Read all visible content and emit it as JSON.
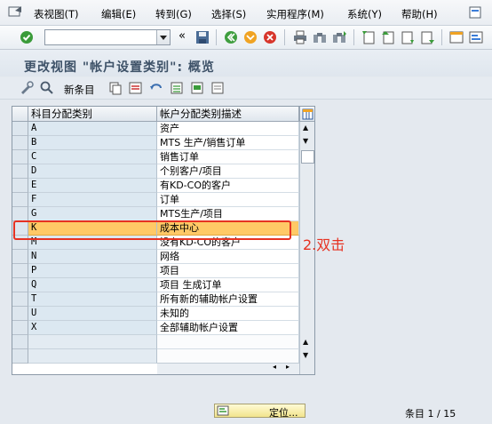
{
  "menu": {
    "items": [
      "表视图(T)",
      "编辑(E)",
      "转到(G)",
      "选择(S)",
      "实用程序(M)",
      "系统(Y)",
      "帮助(H)"
    ]
  },
  "toolbar": {
    "command_field": "",
    "icons": [
      "enter-icon",
      "save-icon",
      "back-icon",
      "exit-icon",
      "cancel-icon",
      "print-icon",
      "find-icon",
      "find-next-icon",
      "first-page-icon",
      "prev-page-icon",
      "next-page-icon",
      "last-page-icon",
      "new-session-icon",
      "shortcut-icon"
    ]
  },
  "screen": {
    "title": "更改视图 \"帐户设置类别\": 概览"
  },
  "app_toolbar": {
    "new_entries": "新条目"
  },
  "table": {
    "headers": [
      "科目分配类别",
      "帐户分配类别描述"
    ],
    "rows": [
      {
        "code": "A",
        "desc": "资产"
      },
      {
        "code": "B",
        "desc": "MTS 生产/销售订单"
      },
      {
        "code": "C",
        "desc": "销售订单"
      },
      {
        "code": "D",
        "desc": "个别客户/项目"
      },
      {
        "code": "E",
        "desc": "有KD-CO的客户"
      },
      {
        "code": "F",
        "desc": "订单"
      },
      {
        "code": "G",
        "desc": "MTS生产/项目"
      },
      {
        "code": "K",
        "desc": "成本中心"
      },
      {
        "code": "M",
        "desc": "没有KD-CO的客户"
      },
      {
        "code": "N",
        "desc": "网络"
      },
      {
        "code": "P",
        "desc": "项目"
      },
      {
        "code": "Q",
        "desc": "项目 生成订单"
      },
      {
        "code": "T",
        "desc": "所有新的辅助帐户设置"
      },
      {
        "code": "U",
        "desc": "未知的"
      },
      {
        "code": "X",
        "desc": "全部辅助帐户设置"
      }
    ],
    "highlighted_code": "K"
  },
  "annotation": "2.双击",
  "bottom": {
    "position_button": "定位...",
    "entry_label": "条目",
    "entry_count": "1 / 15"
  },
  "colors": {
    "highlight": "#ffc966",
    "annotation": "#e63222",
    "title": "#3e5268"
  }
}
